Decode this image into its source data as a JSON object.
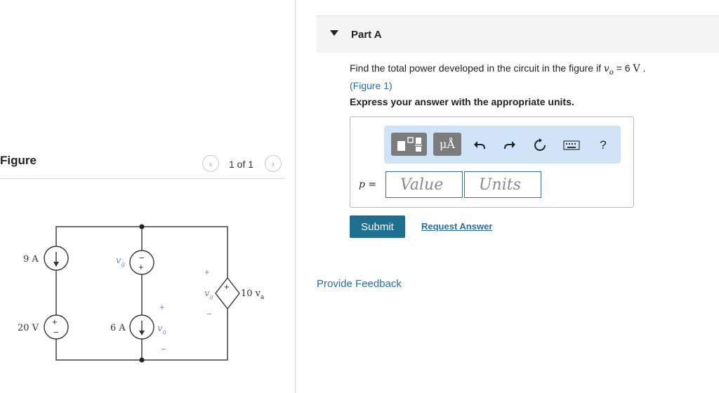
{
  "figure": {
    "title": "Figure",
    "pager": "1 of 1",
    "prev_icon": "chevron-left-icon",
    "next_icon": "chevron-right-icon",
    "circuit": {
      "source_9a": "9 A",
      "source_20v": "20 V",
      "source_6a": "6 A",
      "vg_label": "v",
      "vg_sub": "g",
      "va_label": "v",
      "va_sub": "a",
      "dependent": "10 v",
      "dependent_sub": "a",
      "plus": "+",
      "minus": "−"
    }
  },
  "part": {
    "title": "Part A",
    "question_prefix": "Find the total power developed in the circuit in the figure if ",
    "question_var": "v",
    "question_sub": "o",
    "question_eq": " = 6 ",
    "question_unit": "V",
    "question_end": " .",
    "figure_link": "(Figure 1)",
    "instruction": "Express your answer with the appropriate units.",
    "toolbar": {
      "units_label": "μÅ",
      "help_label": "?"
    },
    "answer": {
      "var": "p",
      "eq": " =",
      "value_placeholder": "Value",
      "units_placeholder": "Units"
    },
    "submit_label": "Submit",
    "request_label": "Request Answer"
  },
  "feedback_label": "Provide Feedback",
  "colors": {
    "accent": "#1c6f8f",
    "link": "#2a6ea5",
    "toolbar_bg": "#cfe4f7"
  }
}
